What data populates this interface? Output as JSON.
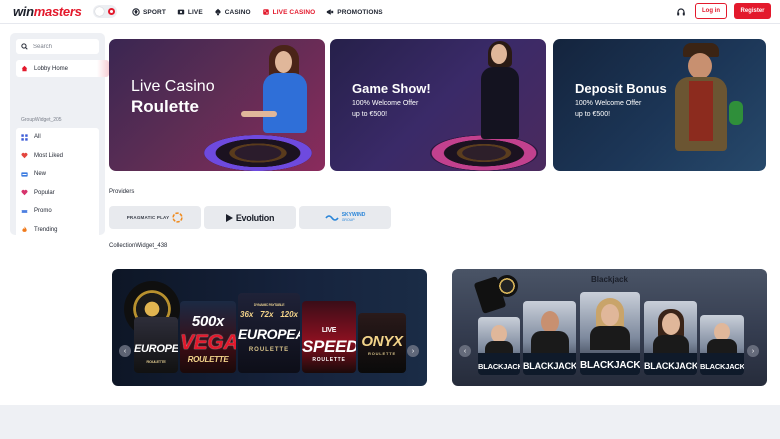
{
  "header": {
    "logo": {
      "part1": "win",
      "part2": "masters"
    },
    "nav": [
      {
        "label": "SPORT",
        "icon": "sport-icon"
      },
      {
        "label": "LIVE",
        "icon": "live-icon"
      },
      {
        "label": "CASINO",
        "icon": "casino-icon"
      },
      {
        "label": "LIVE CASINO",
        "icon": "live-casino-icon",
        "active": true
      },
      {
        "label": "PROMOTIONS",
        "icon": "promotions-icon"
      }
    ],
    "login_label": "Log in",
    "register_label": "Register"
  },
  "sidebar": {
    "search_placeholder": "Search",
    "lobby_label": "Lobby Home",
    "group_label": "GroupWidget_205",
    "items": [
      {
        "label": "All",
        "icon": "grid-icon"
      },
      {
        "label": "Most Liked",
        "icon": "heart-icon"
      },
      {
        "label": "New",
        "icon": "new-icon"
      },
      {
        "label": "Popular",
        "icon": "popular-icon"
      },
      {
        "label": "Promo",
        "icon": "promo-icon"
      },
      {
        "label": "Trending",
        "icon": "flame-icon"
      }
    ]
  },
  "banners": [
    {
      "title_line1": "Live Casino",
      "title_line2": "Roulette"
    },
    {
      "title": "Game Show!",
      "sub_line1": "100% Welcome Offer",
      "sub_line2": "up to €500!"
    },
    {
      "title": "Deposit Bonus",
      "sub_line1": "100% Welcome Offer",
      "sub_line2": "up to €500!"
    }
  ],
  "providers": {
    "label": "Providers",
    "items": [
      {
        "name": "PRAGMATIC PLAY"
      },
      {
        "name": "Evolution"
      },
      {
        "name": "SKYWIND",
        "sub": "GROUP"
      }
    ]
  },
  "collection": {
    "label": "CollectionWidget_438",
    "roulette_cards": [
      {
        "top": "",
        "main": "EUROPEAN",
        "sub": "ROULETTE"
      },
      {
        "top": "500x",
        "main": "VEGA",
        "sub": "ROULETTE"
      },
      {
        "top": "DYNAMIC PAYTABLE",
        "main": "EUROPEAN",
        "sub": "ROULETTE",
        "multipliers": [
          "36x",
          "72x",
          "120x"
        ]
      },
      {
        "top": "LIVE",
        "main": "SPEED",
        "sub": "ROULETTE"
      },
      {
        "top": "",
        "main": "ONYX",
        "sub": "ROULETTE"
      }
    ],
    "blackjack_title": "Blackjack",
    "blackjack_cards": [
      "BLACKJACK",
      "BLACKJACK",
      "BLACKJACK",
      "BLACKJACK",
      "BLACKJACK"
    ]
  },
  "colors": {
    "brand": "#e3192c",
    "sidebar_bg": "#eef0f4",
    "banner_roulette": "#5c2d54",
    "banner_gameshow": "#3a2a68",
    "banner_deposit": "#1c3657"
  }
}
